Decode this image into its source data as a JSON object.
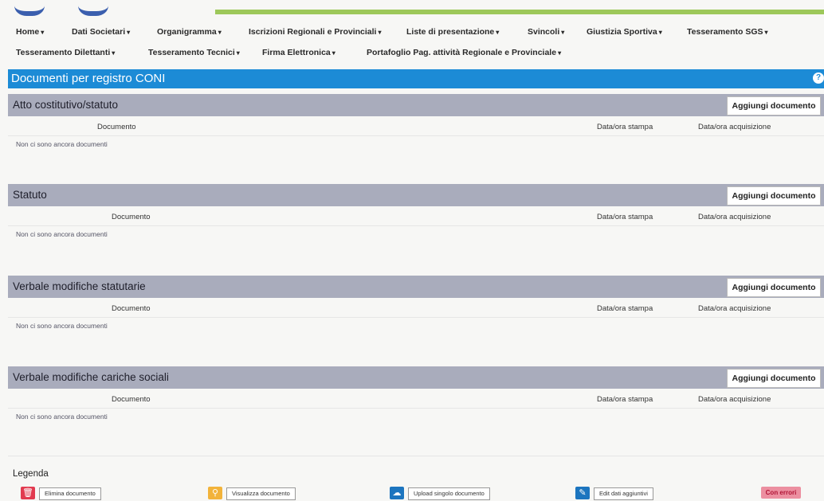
{
  "nav": {
    "row1": [
      {
        "label": "Home"
      },
      {
        "label": "Dati Societari"
      },
      {
        "label": "Organigramma"
      },
      {
        "label": "Iscrizioni Regionali e Provinciali"
      },
      {
        "label": "Liste di presentazione"
      },
      {
        "label": "Svincoli"
      },
      {
        "label": "Giustizia Sportiva"
      },
      {
        "label": "Tesseramento SGS"
      }
    ],
    "row2": [
      {
        "label": "Tesseramento Dilettanti"
      },
      {
        "label": "Tesseramento Tecnici"
      },
      {
        "label": "Firma Elettronica"
      },
      {
        "label": "Portafoglio Pag. attività Regionale e Provinciale"
      }
    ]
  },
  "page": {
    "title": "Documenti per registro CONI"
  },
  "sections": [
    {
      "title": "Atto costitutivo/statuto",
      "add_label": "Aggiungi documento",
      "col_documento": "Documento",
      "col_stampa": "Data/ora stampa",
      "col_acquisizione": "Data/ora acquisizione",
      "empty_text": "Non ci sono ancora documenti"
    },
    {
      "title": "Statuto",
      "add_label": "Aggiungi documento",
      "col_documento": "Documento",
      "col_stampa": "Data/ora stampa",
      "col_acquisizione": "Data/ora acquisizione",
      "empty_text": "Non ci sono ancora documenti"
    },
    {
      "title": "Verbale modifiche statutarie",
      "add_label": "Aggiungi documento",
      "col_documento": "Documento",
      "col_stampa": "Data/ora stampa",
      "col_acquisizione": "Data/ora acquisizione",
      "empty_text": "Non ci sono ancora documenti"
    },
    {
      "title": "Verbale modifiche cariche sociali",
      "add_label": "Aggiungi documento",
      "col_documento": "Documento",
      "col_stampa": "Data/ora stampa",
      "col_acquisizione": "Data/ora acquisizione",
      "empty_text": "Non ci sono ancora documenti"
    }
  ],
  "legend": {
    "title": "Legenda",
    "items": [
      {
        "label": "Elimina documento",
        "icon": "trash-icon",
        "color": "#e23a4f"
      },
      {
        "label": "Visualizza documento",
        "icon": "search-icon",
        "color": "#f2b33a"
      },
      {
        "label": "Upload singolo documento",
        "icon": "cloud-upload-icon",
        "color": "#1c75bf"
      },
      {
        "label": "Edit dati aggiuntivi",
        "icon": "pencil-icon",
        "color": "#1c75bf"
      }
    ],
    "error_badge": "Con errori"
  },
  "colors": {
    "header_blue": "#1c8bd6",
    "section_bar": "#a9acbc",
    "accent_green": "#9dc85a"
  }
}
